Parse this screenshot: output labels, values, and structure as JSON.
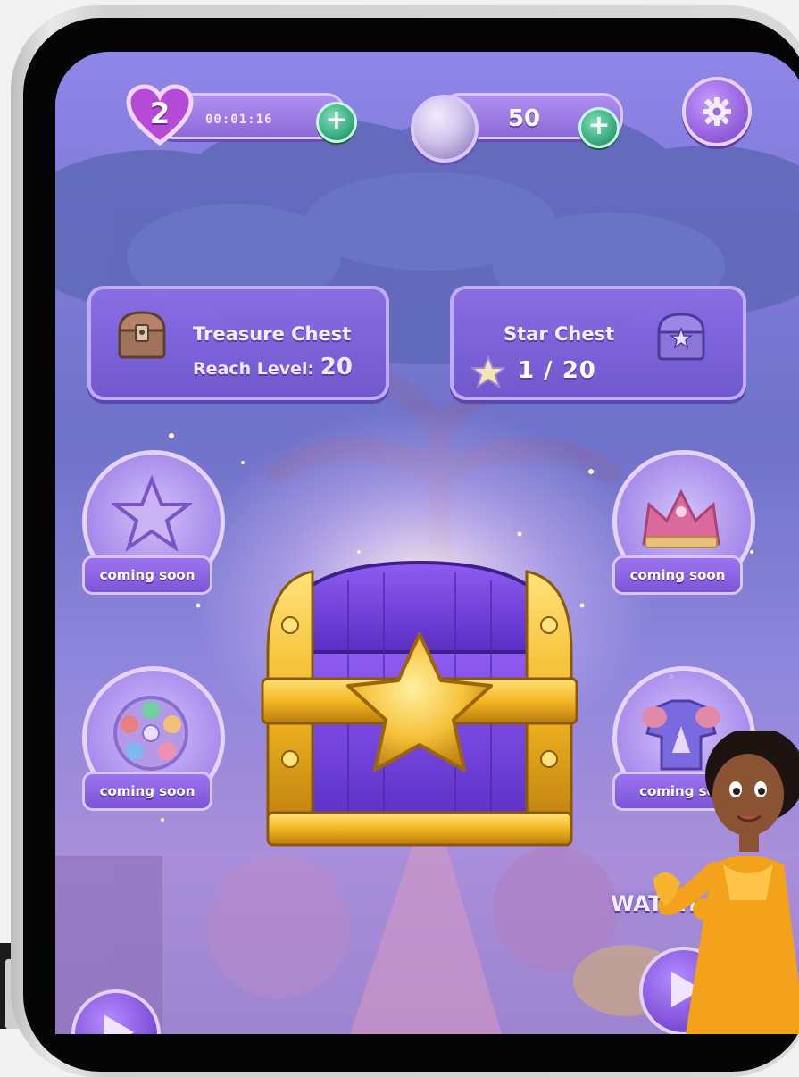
{
  "hud": {
    "lives": "2",
    "timer": "00:01:16",
    "coins": "50",
    "add_lives_icon": "plus-icon",
    "add_coins_icon": "plus-icon",
    "settings_icon": "gear-icon"
  },
  "chests": {
    "treasure": {
      "title": "Treasure Chest",
      "reach_label": "Reach Level:",
      "level": "20"
    },
    "star": {
      "title": "Star Chest",
      "progress": "1 / 20",
      "progress_value": 1,
      "progress_max": 20
    }
  },
  "features": [
    {
      "icon": "star-icon",
      "label": "coming soon"
    },
    {
      "icon": "crown-icon",
      "label": "coming soon"
    },
    {
      "icon": "color-wheel-icon",
      "label": "coming soon"
    },
    {
      "icon": "armor-icon",
      "label": "coming so"
    }
  ],
  "center_chest": {
    "icon": "treasure-chest-icon"
  },
  "watch": {
    "label": "WATCH"
  },
  "colors": {
    "accent_purple": "#8b6ad8",
    "gold": "#f2b722",
    "green_plus": "#2fa37a"
  }
}
